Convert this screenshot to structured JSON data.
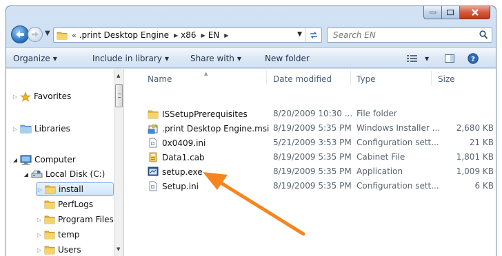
{
  "window": {
    "controls": {
      "minimize": "minimize",
      "maximize": "maximize",
      "close": "close"
    }
  },
  "address": {
    "overflow": "«",
    "breadcrumbs": [
      ".print Desktop Engine",
      "x86",
      "EN"
    ],
    "separator": "▶"
  },
  "search": {
    "placeholder": "Search EN"
  },
  "toolbar": {
    "organize": "Organize",
    "include_in_library": "Include in library",
    "share_with": "Share with",
    "new_folder": "New folder"
  },
  "nav_pane": {
    "favorites": "Favorites",
    "libraries": "Libraries",
    "computer": "Computer",
    "local_disk": "Local Disk (C:)",
    "folders": [
      "install",
      "PerfLogs",
      "Program Files",
      "temp",
      "Users"
    ],
    "selected": "install"
  },
  "columns": {
    "name": "Name",
    "date": "Date modified",
    "type": "Type",
    "size": "Size"
  },
  "files": [
    {
      "name": "ISSetupPrerequisites",
      "date": "8/20/2009 10:30 ...",
      "type": "File folder",
      "size": "",
      "icon": "folder-icon"
    },
    {
      "name": ".print Desktop Engine.msi",
      "date": "8/19/2009 5:35 PM",
      "type": "Windows Installer ...",
      "size": "2,680 KB",
      "icon": "msi-installer-icon"
    },
    {
      "name": "0x0409.ini",
      "date": "5/21/2009 3:53 PM",
      "type": "Configuration sett...",
      "size": "21 KB",
      "icon": "ini-file-icon"
    },
    {
      "name": "Data1.cab",
      "date": "8/19/2009 5:35 PM",
      "type": "Cabinet File",
      "size": "1,801 KB",
      "icon": "cabinet-file-icon"
    },
    {
      "name": "setup.exe",
      "date": "8/19/2009 5:35 PM",
      "type": "Application",
      "size": "1,009 KB",
      "icon": "application-icon"
    },
    {
      "name": "Setup.ini",
      "date": "8/19/2009 5:35 PM",
      "type": "Configuration sett...",
      "size": "6 KB",
      "icon": "ini-file-icon"
    }
  ],
  "colors": {
    "annotation_arrow": "#f5861f",
    "folder": "#e8b93a",
    "selection": "#cfe5fb"
  }
}
